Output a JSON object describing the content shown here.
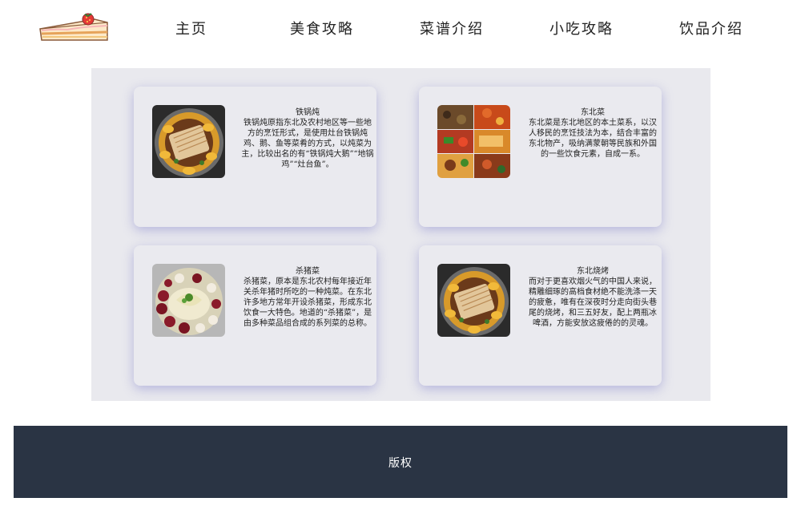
{
  "nav": {
    "logo_icon": "cake-icon",
    "items": [
      {
        "label": "主页"
      },
      {
        "label": "美食攻略"
      },
      {
        "label": "菜谱介绍"
      },
      {
        "label": "小吃攻略"
      },
      {
        "label": "饮品介绍"
      }
    ]
  },
  "cards": [
    {
      "title": "铁锅炖",
      "text": "铁锅炖原指东北及农村地区等一些地方的烹饪形式，是使用灶台铁锅炖鸡、鹅、鱼等菜肴的方式，以炖菜为主，比较出名的有“铁锅炖大鹅”“地锅鸡”“灶台鱼”。",
      "image": "iron-pot-stew-photo"
    },
    {
      "title": "东北菜",
      "text": "东北菜是东北地区的本土菜系，以汉人移民的烹饪技法为本，结合丰富的东北物产，吸纳满蒙朝等民族和外国的一些饮食元素，自成一系。",
      "image": "northeast-dishes-collage-photo"
    },
    {
      "title": "杀猪菜",
      "text": "杀猪菜，原本是东北农村每年接近年关杀年猪时所吃的一种炖菜。在东北许多地方常年开设杀猪菜，形成东北饮食一大特色。地道的“杀猪菜”，是由多种菜品组合成的系列菜的总称。",
      "image": "pig-killing-dish-photo"
    },
    {
      "title": "东北烧烤",
      "text": "而对于更喜欢烟火气的中国人来说，精雕细琢的高档食材绝不能洗涤一天的疲惫，唯有在深夜时分走向街头巷尾的烧烤，和三五好友，配上两瓶冰啤酒，方能安放这疲倦的的灵魂。",
      "image": "northeast-bbq-photo"
    }
  ],
  "footer": {
    "copyright": "版权"
  }
}
